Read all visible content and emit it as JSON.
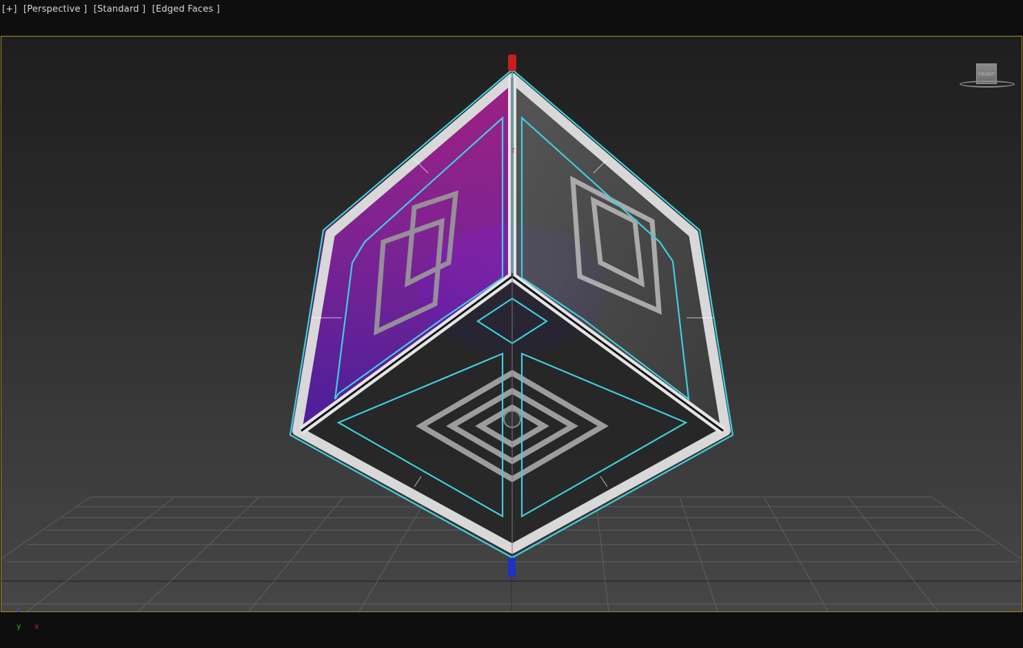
{
  "viewport": {
    "labels": {
      "menu": "[+]",
      "view": "[Perspective ]",
      "shading_mode": "[Standard ]",
      "display": "[Edged Faces ]"
    },
    "view_cube": {
      "face_label": "FRONT"
    },
    "gizmo_label": "z",
    "axis_tripod": {
      "z": "z",
      "y": "y",
      "x": "x"
    }
  },
  "colors": {
    "viewport_border": "#a58f2e",
    "selection_outline": "#3fd0e0",
    "x_axis": "#d02020",
    "y_axis": "#3ab03a",
    "z_axis": "#2040d0",
    "magenta_face": "#a0208a",
    "purple_face": "#5a1ea8"
  }
}
